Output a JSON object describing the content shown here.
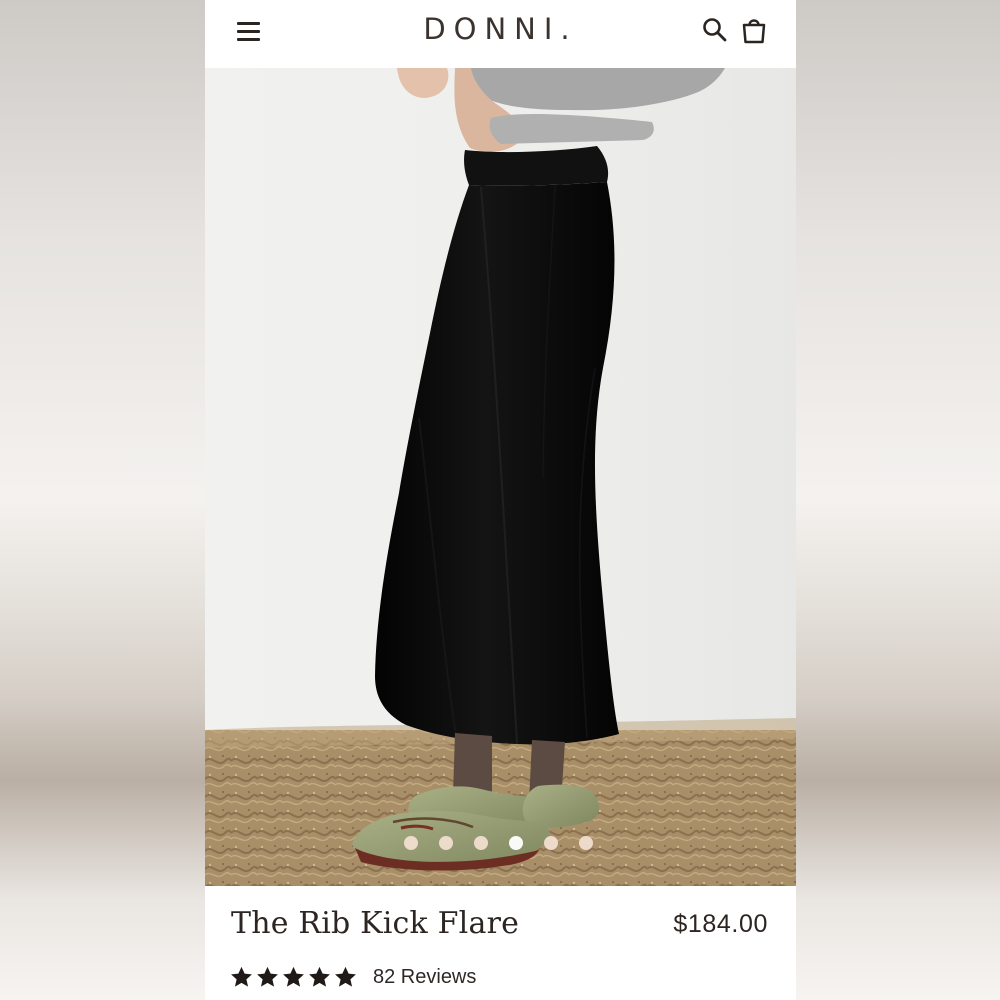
{
  "header": {
    "brand": "DONNI.",
    "menu_icon": "hamburger-menu-icon",
    "search_icon": "search-icon",
    "cart_icon": "shopping-bag-icon"
  },
  "gallery": {
    "slides_total": 6,
    "active_slide": 4
  },
  "product": {
    "title": "The Rib Kick Flare",
    "price": "$184.00",
    "rating": 5,
    "reviews_label": "82 Reviews"
  },
  "colors": {
    "text": "#2c2522",
    "pants": "#111111",
    "shoe": "#98a173",
    "rug": "#a98f67",
    "dot_inactive": "#f1ded0",
    "dot_active": "#ffffff"
  }
}
